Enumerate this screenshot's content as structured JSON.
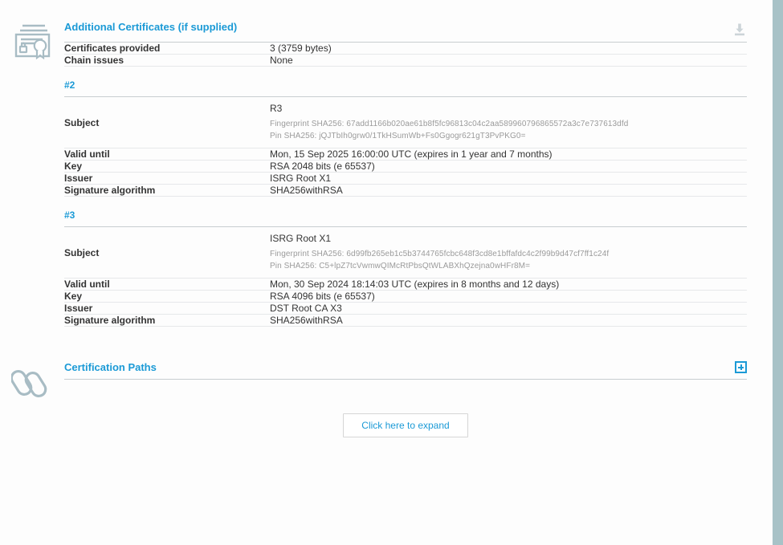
{
  "sections": {
    "additional_certificates": {
      "title": "Additional Certificates (if supplied)",
      "icon": "certificate-icon",
      "action_icon": "download-icon",
      "summary_rows": [
        {
          "label": "Certificates provided",
          "value": "3 (3759 bytes)"
        },
        {
          "label": "Chain issues",
          "value": "None"
        }
      ],
      "certificates": [
        {
          "index_label": "#2",
          "subject_label": "Subject",
          "subject_name": "R3",
          "fingerprint": "Fingerprint SHA256: 67add1166b020ae61b8f5fc96813c04c2aa589960796865572a3c7e737613dfd",
          "pin": "Pin SHA256: jQJTbIh0grw0/1TkHSumWb+Fs0Ggogr621gT3PvPKG0=",
          "rows": [
            {
              "label": "Valid until",
              "value": "Mon, 15 Sep 2025 16:00:00 UTC (expires in 1 year and 7 months)"
            },
            {
              "label": "Key",
              "value": "RSA 2048 bits (e 65537)"
            },
            {
              "label": "Issuer",
              "value": "ISRG Root X1"
            },
            {
              "label": "Signature algorithm",
              "value": "SHA256withRSA"
            }
          ]
        },
        {
          "index_label": "#3",
          "subject_label": "Subject",
          "subject_name": "ISRG Root X1",
          "fingerprint": "Fingerprint SHA256: 6d99fb265eb1c5b3744765fcbc648f3cd8e1bffafdc4c2f99b9d47cf7ff1c24f",
          "pin": "Pin SHA256: C5+lpZ7tcVwmwQIMcRtPbsQtWLABXhQzejna0wHFr8M=",
          "rows": [
            {
              "label": "Valid until",
              "value": "Mon, 30 Sep 2024 18:14:03 UTC (expires in 8 months and 12 days)"
            },
            {
              "label": "Key",
              "value": "RSA 4096 bits (e 65537)"
            },
            {
              "label": "Issuer",
              "value": "DST Root CA X3"
            },
            {
              "label": "Signature algorithm",
              "value": "SHA256withRSA"
            }
          ]
        }
      ]
    },
    "certification_paths": {
      "title": "Certification Paths",
      "icon": "chain-link-icon",
      "action_icon": "plus-expand-icon",
      "expand_button_label": "Click here to expand"
    }
  },
  "colors": {
    "accent": "#1b9ad6",
    "icon_gray": "#a8bcc4",
    "text": "#333333",
    "muted_text": "#9b9b9b",
    "edge": "#a8c2c7"
  }
}
